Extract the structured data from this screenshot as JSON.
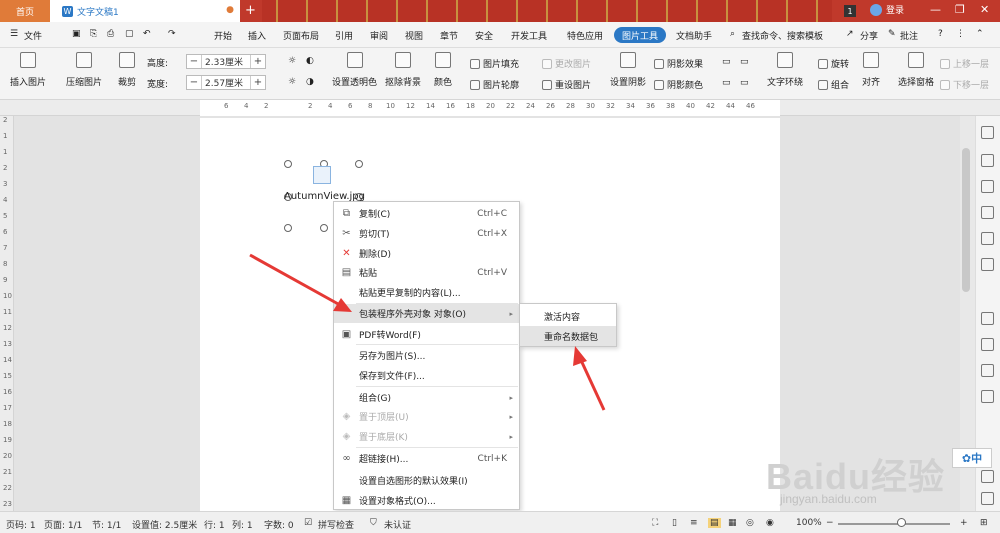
{
  "colors": {
    "accent": "#2b78c5",
    "title_bar": "#c0392b",
    "home_tab": "#e07b39",
    "arrow": "#e53935"
  },
  "titlebar": {
    "home_tab": "首页",
    "doc_tab": "文字文稿1",
    "badge": "1",
    "user": "登录"
  },
  "menu": {
    "file": "文件",
    "items": [
      "开始",
      "插入",
      "页面布局",
      "引用",
      "审阅",
      "视图",
      "章节",
      "安全",
      "开发工具",
      "特色应用"
    ],
    "active": "图片工具",
    "doc_helper": "文档助手",
    "search": "查找命令、搜索模板",
    "share": "分享",
    "annotate": "批注"
  },
  "toolbar": {
    "insert_pic": "插入图片",
    "compress": "压缩图片",
    "crop": "裁剪",
    "height_label": "高度:",
    "height_value": "2.33厘米",
    "width_label": "宽度:",
    "width_value": "2.57厘米",
    "transparent": "设置透明色",
    "remove_bg": "抠除背景",
    "color": "颜色",
    "pic_fill": "图片填充",
    "pic_outline": "图片轮廓",
    "change_pic": "更改图片",
    "reset_pic": "重设图片",
    "set_shadow": "设置阴影",
    "shadow_effect": "阴影效果",
    "shadow_color": "阴影颜色",
    "wrap": "文字环绕",
    "rotate": "旋转",
    "group": "组合",
    "align": "对齐",
    "select_pane": "选择窗格",
    "up_one": "上移一层",
    "down_one": "下移一层"
  },
  "ruler": {
    "h": [
      "6",
      "4",
      "2",
      "2",
      "4",
      "6",
      "8",
      "10",
      "12",
      "14",
      "16",
      "18",
      "20",
      "22",
      "24",
      "26",
      "28",
      "30",
      "32",
      "34",
      "36",
      "38",
      "40",
      "42",
      "44",
      "46"
    ],
    "v": [
      "2",
      "1",
      "1",
      "2",
      "3",
      "4",
      "5",
      "6",
      "7",
      "8",
      "9",
      "10",
      "11",
      "12",
      "13",
      "14",
      "15",
      "16",
      "17",
      "18",
      "19",
      "20",
      "21",
      "22",
      "23"
    ]
  },
  "object": {
    "filename": "AutumnView.jpg"
  },
  "context_menu": [
    {
      "icon": "copy-icon",
      "glyph": "⧉",
      "label": "复制(C)",
      "shortcut": "Ctrl+C",
      "disabled": false,
      "highlight": false
    },
    {
      "icon": "cut-icon",
      "glyph": "✂",
      "label": "剪切(T)",
      "shortcut": "Ctrl+X",
      "disabled": false,
      "highlight": false
    },
    {
      "icon": "delete-icon",
      "glyph": "✕",
      "label": "删除(D)",
      "shortcut": "",
      "disabled": false,
      "highlight": false
    },
    {
      "icon": "paste-icon",
      "glyph": "▤",
      "label": "粘贴",
      "shortcut": "Ctrl+V",
      "disabled": false,
      "highlight": false
    },
    {
      "icon": "",
      "glyph": "",
      "label": "粘贴更早复制的内容(L)...",
      "shortcut": "",
      "disabled": false,
      "highlight": false
    },
    {
      "icon": "",
      "glyph": "",
      "label": "包装程序外壳对象 对象(O)",
      "shortcut": "",
      "disabled": false,
      "highlight": true,
      "submenu": true
    },
    {
      "icon": "pdf-icon",
      "glyph": "▣",
      "label": "PDF转Word(F)",
      "shortcut": "",
      "disabled": false,
      "highlight": false
    },
    {
      "icon": "",
      "glyph": "",
      "label": "另存为图片(S)...",
      "shortcut": "",
      "disabled": false,
      "highlight": false
    },
    {
      "icon": "",
      "glyph": "",
      "label": "保存到文件(F)...",
      "shortcut": "",
      "disabled": false,
      "highlight": false
    },
    {
      "icon": "",
      "glyph": "",
      "label": "组合(G)",
      "shortcut": "",
      "disabled": false,
      "highlight": false,
      "submenu": true
    },
    {
      "icon": "bring-front-icon",
      "glyph": "◈",
      "label": "置于顶层(U)",
      "shortcut": "",
      "disabled": true,
      "highlight": false,
      "submenu": true
    },
    {
      "icon": "send-back-icon",
      "glyph": "◈",
      "label": "置于底层(K)",
      "shortcut": "",
      "disabled": true,
      "highlight": false,
      "submenu": true
    },
    {
      "icon": "hyperlink-icon",
      "glyph": "∞",
      "label": "超链接(H)...",
      "shortcut": "Ctrl+K",
      "disabled": false,
      "highlight": false
    },
    {
      "icon": "",
      "glyph": "",
      "label": "设置自选图形的默认效果(I)",
      "shortcut": "",
      "disabled": false,
      "highlight": false
    },
    {
      "icon": "format-object-icon",
      "glyph": "▦",
      "label": "设置对象格式(O)...",
      "shortcut": "",
      "disabled": false,
      "highlight": false
    }
  ],
  "submenu": {
    "activate": "激活内容",
    "rename": "重命名数据包"
  },
  "status": {
    "page_code": "页码: 1",
    "page": "页面: 1/1",
    "section": "节: 1/1",
    "setting": "设置值: 2.5厘米",
    "row": "行: 1",
    "col": "列: 1",
    "words": "字数: 0",
    "spell": "拼写检查",
    "auth": "未认证",
    "zoom": "100%"
  },
  "watermark": {
    "brand": "Baidu经验",
    "url": "jingyan.baidu.com",
    "ime": "中"
  }
}
